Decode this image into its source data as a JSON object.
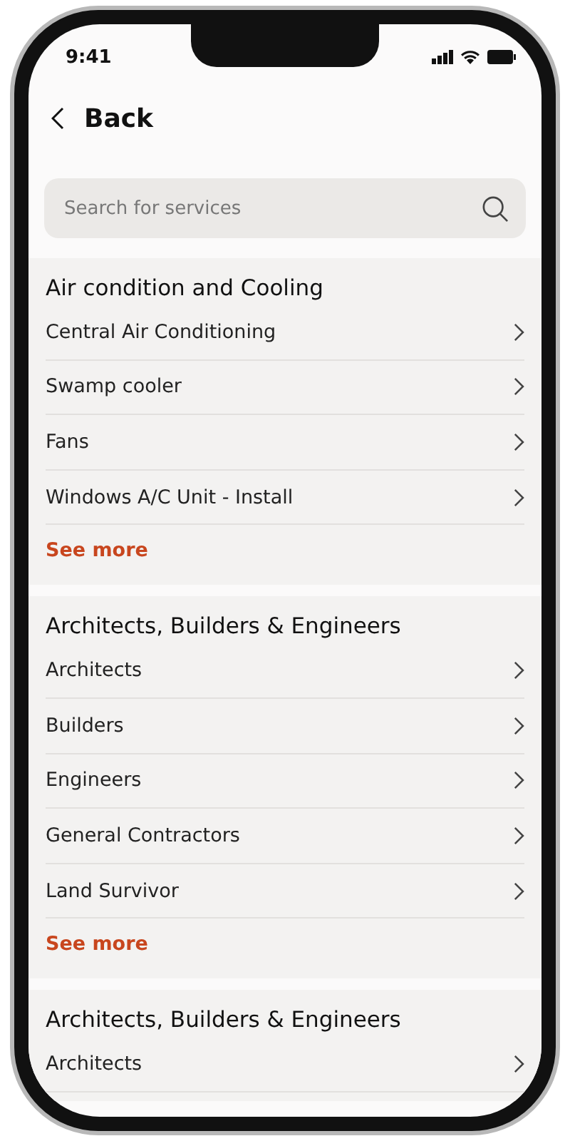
{
  "status_bar": {
    "time": "9:41"
  },
  "header": {
    "back_label": "Back"
  },
  "search": {
    "placeholder": "Search for services"
  },
  "sections": [
    {
      "title": "Air condition and Cooling",
      "items": [
        "Central Air Conditioning",
        "Swamp cooler",
        "Fans",
        "Windows A/C Unit - Install"
      ],
      "see_more": "See more"
    },
    {
      "title": "Architects, Builders & Engineers",
      "items": [
        "Architects",
        "Builders",
        "Engineers",
        "General Contractors",
        "Land Survivor"
      ],
      "see_more": "See more"
    },
    {
      "title": "Architects, Builders & Engineers",
      "items": [
        "Architects"
      ]
    }
  ]
}
